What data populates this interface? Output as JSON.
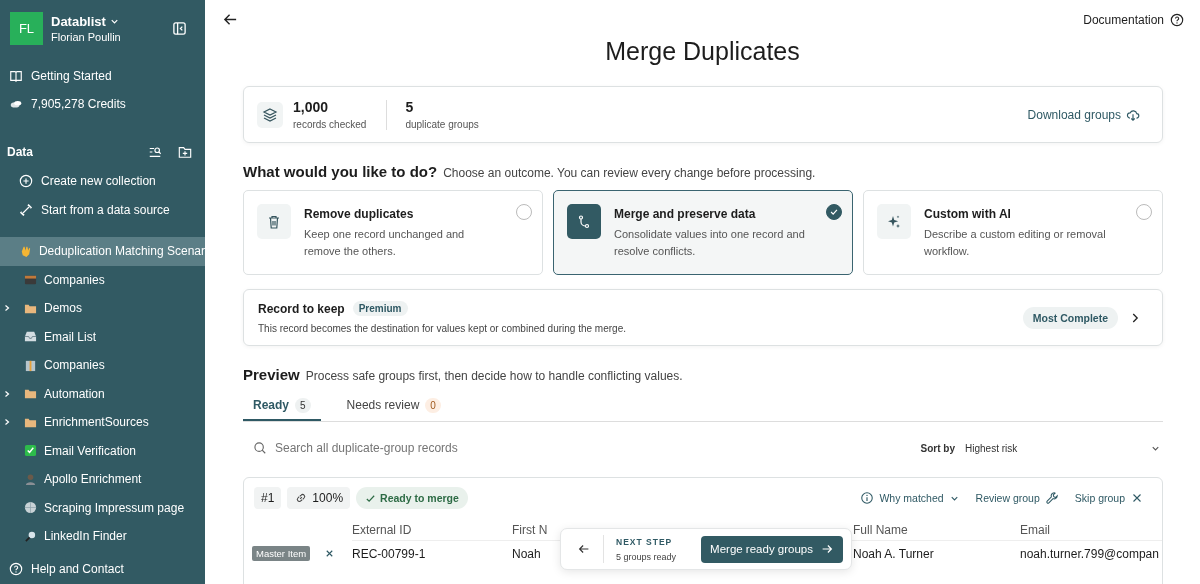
{
  "sidebar": {
    "workspace": {
      "avatar": "FL",
      "name": "Datablist",
      "user": "Florian Poullin"
    },
    "links": [
      "Getting Started",
      "7,905,278 Credits"
    ],
    "section_title": "Data",
    "actions": [
      "Create new collection",
      "Start from a data source"
    ],
    "collections": [
      {
        "label": "Deduplication Matching Scenar",
        "selected": true,
        "expandable": false
      },
      {
        "label": "Companies",
        "selected": false,
        "expandable": false
      },
      {
        "label": "Demos",
        "selected": false,
        "expandable": true
      },
      {
        "label": "Email List",
        "selected": false,
        "expandable": false
      },
      {
        "label": "Companies",
        "selected": false,
        "expandable": false
      },
      {
        "label": "Automation",
        "selected": false,
        "expandable": true
      },
      {
        "label": "EnrichmentSources",
        "selected": false,
        "expandable": true
      },
      {
        "label": "Email Verification",
        "selected": false,
        "expandable": false
      },
      {
        "label": "Apollo Enrichment",
        "selected": false,
        "expandable": false
      },
      {
        "label": "Scraping Impressum page",
        "selected": false,
        "expandable": false
      },
      {
        "label": "LinkedIn Finder",
        "selected": false,
        "expandable": false
      }
    ],
    "help": "Help and Contact"
  },
  "documentation": "Documentation",
  "title": "Merge Duplicates",
  "stats": [
    {
      "value": "1,000",
      "label": "records checked"
    },
    {
      "value": "5",
      "label": "duplicate groups"
    }
  ],
  "download": "Download groups",
  "outcome": {
    "heading": "What would you like to do?",
    "hint": "Choose an outcome. You can review every change before processing.",
    "options": [
      {
        "title": "Remove duplicates",
        "description": "Keep one record unchanged and remove the others.",
        "selected": false
      },
      {
        "title": "Merge and preserve data",
        "description": "Consolidate values into one record and resolve conflicts.",
        "selected": true
      },
      {
        "title": "Custom with AI",
        "description": "Describe a custom editing or removal workflow.",
        "selected": false
      }
    ]
  },
  "record_to_keep": {
    "title": "Record to keep",
    "badge": "Premium",
    "description": "This record becomes the destination for values kept or combined during the merge.",
    "value": "Most Complete"
  },
  "preview": {
    "heading": "Preview",
    "hint": "Process safe groups first, then decide how to handle conflicting values.",
    "tabs": [
      {
        "label": "Ready",
        "count": "5",
        "selected": true,
        "kind": "neutral"
      },
      {
        "label": "Needs review",
        "count": "0",
        "selected": false,
        "kind": "warning"
      }
    ],
    "search_placeholder": "Search all duplicate-group records",
    "sort_label": "Sort by",
    "sort_value": "Highest risk"
  },
  "group": {
    "number": "#1",
    "score": "100%",
    "status": "Ready to merge",
    "actions": [
      "Why matched",
      "Review group",
      "Skip group"
    ],
    "columns": [
      "External ID",
      "First N",
      "Full Name",
      "Email"
    ],
    "rows": [
      {
        "badge": "Master Item",
        "cells": [
          "REC-00799-1",
          "Noah",
          "Noah A. Turner",
          "noah.turner.799@compan"
        ]
      }
    ]
  },
  "next_step": {
    "label": "NEXT STEP",
    "sub": "5 groups ready",
    "button": "Merge ready groups"
  }
}
